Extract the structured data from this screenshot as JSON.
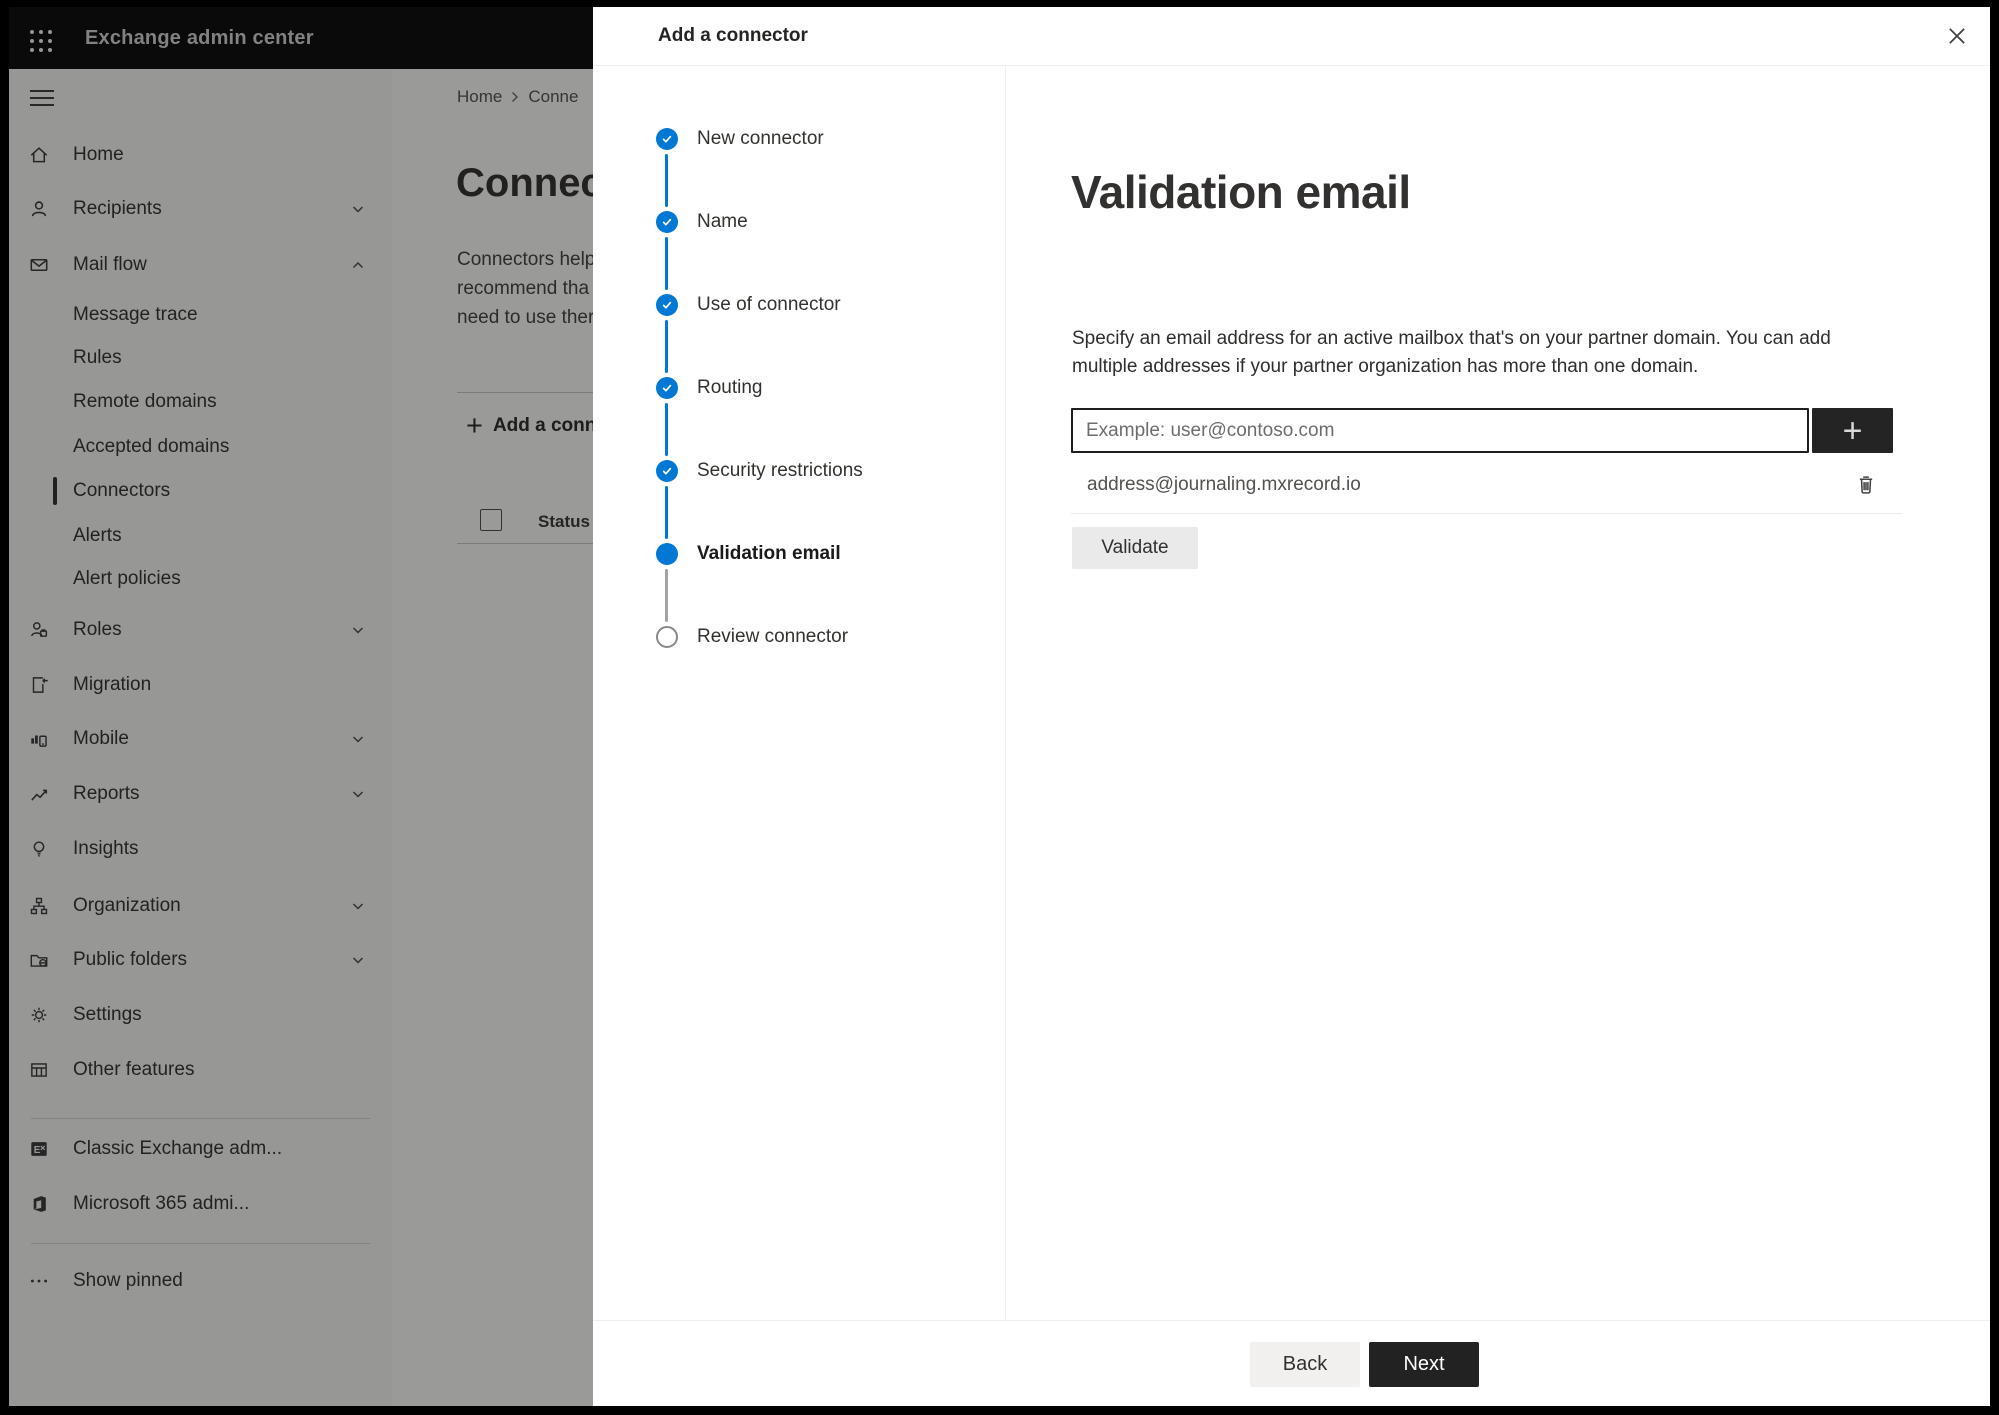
{
  "topbar": {
    "title": "Exchange admin center"
  },
  "sidebar": {
    "items": [
      {
        "label": "Home"
      },
      {
        "label": "Recipients"
      },
      {
        "label": "Mail flow"
      },
      {
        "label": "Message trace"
      },
      {
        "label": "Rules"
      },
      {
        "label": "Remote domains"
      },
      {
        "label": "Accepted domains"
      },
      {
        "label": "Connectors"
      },
      {
        "label": "Alerts"
      },
      {
        "label": "Alert policies"
      },
      {
        "label": "Roles"
      },
      {
        "label": "Migration"
      },
      {
        "label": "Mobile"
      },
      {
        "label": "Reports"
      },
      {
        "label": "Insights"
      },
      {
        "label": "Organization"
      },
      {
        "label": "Public folders"
      },
      {
        "label": "Settings"
      },
      {
        "label": "Other features"
      },
      {
        "label": "Classic Exchange adm..."
      },
      {
        "label": "Microsoft 365 admi..."
      },
      {
        "label": "Show pinned"
      }
    ]
  },
  "background_page": {
    "breadcrumb": {
      "home": "Home",
      "current": "Conne"
    },
    "title": "Connectors",
    "paragraph_lines": [
      "Connectors help",
      "recommend tha",
      "need to use ther"
    ],
    "add_connector_label": "Add a conn",
    "table": {
      "status_header": "Status"
    }
  },
  "dialog": {
    "title": "Add a connector",
    "steps": [
      {
        "label": "New connector",
        "state": "complete"
      },
      {
        "label": "Name",
        "state": "complete"
      },
      {
        "label": "Use of connector",
        "state": "complete"
      },
      {
        "label": "Routing",
        "state": "complete"
      },
      {
        "label": "Security restrictions",
        "state": "complete"
      },
      {
        "label": "Validation email",
        "state": "current"
      },
      {
        "label": "Review connector",
        "state": "upcoming"
      }
    ],
    "content": {
      "heading": "Validation email",
      "description_lines": [
        "Specify an email address for an active mailbox that's on your partner domain. You can add",
        "multiple addresses if your partner organization has more than one domain."
      ],
      "email_input": {
        "value": "",
        "placeholder": "Example: user@contoso.com"
      },
      "add_button_glyph": "+",
      "addresses": [
        "address@journaling.mxrecord.io"
      ],
      "validate_button": "Validate"
    },
    "footer": {
      "back": "Back",
      "next": "Next"
    }
  },
  "colors": {
    "accent_blue": "#0078d4",
    "topbar_bg": "#0b0b0b",
    "dark_button": "#242424",
    "light_button": "#eaeaea",
    "text_primary": "#323130",
    "divider": "#edebe9"
  }
}
